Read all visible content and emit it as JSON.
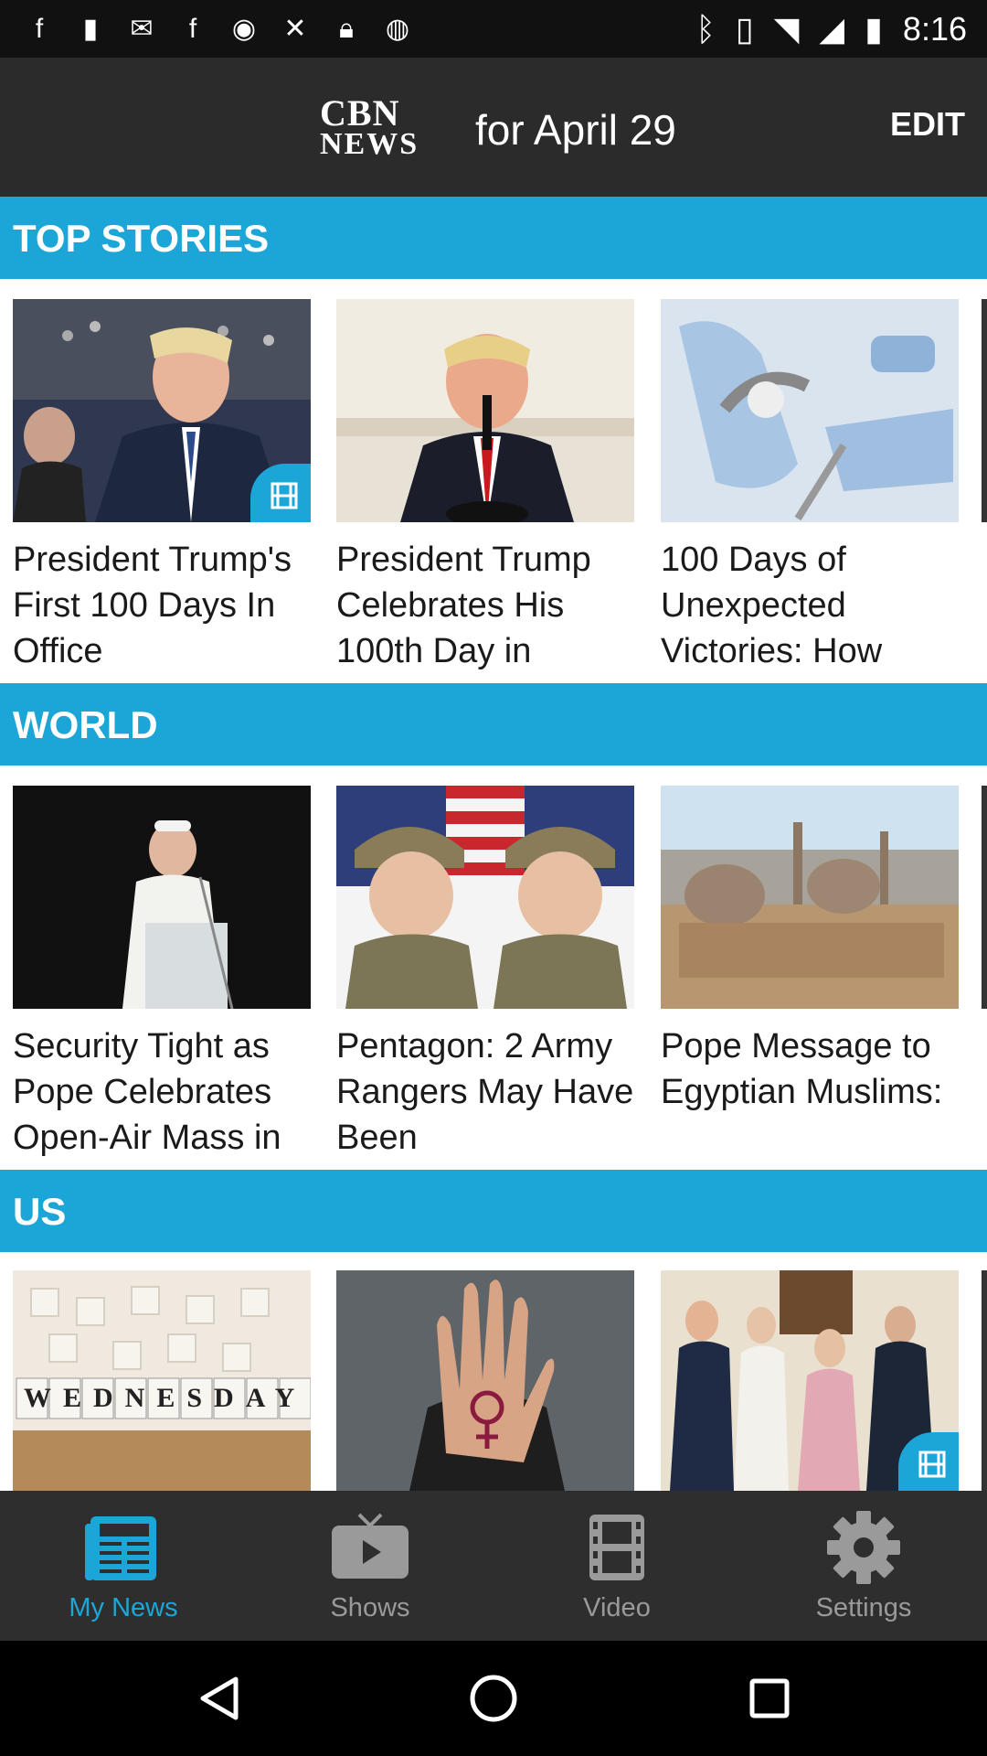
{
  "status_bar": {
    "time": "8:16",
    "left_icons": [
      "facebook-icon",
      "tip-icon",
      "gmail-icon",
      "facebook-icon",
      "circle-icon",
      "satellite-icon",
      "lock-icon",
      "app-icon"
    ],
    "right_icons": [
      "bluetooth-icon",
      "vibrate-icon",
      "wifi-icon",
      "signal-icon",
      "battery-icon"
    ]
  },
  "header": {
    "logo_line1": "CBN",
    "logo_line2": "NEWS",
    "title": "for April 29",
    "edit_label": "EDIT"
  },
  "sections": [
    {
      "label": "TOP STORIES",
      "cards": [
        {
          "caption": "President Trump's First 100 Days In Office",
          "has_video": true
        },
        {
          "caption": "President Trump Celebrates His 100th Day in",
          "has_video": false
        },
        {
          "caption": "100 Days of Unexpected Victories: How",
          "has_video": false
        }
      ]
    },
    {
      "label": "WORLD",
      "cards": [
        {
          "caption": "Security Tight as Pope Celebrates Open-Air Mass in",
          "has_video": false
        },
        {
          "caption": "Pentagon: 2 Army Rangers May Have Been",
          "has_video": false
        },
        {
          "caption": "Pope Message to Egyptian Muslims:",
          "has_video": false
        }
      ]
    },
    {
      "label": "US",
      "cards": [
        {
          "caption": "",
          "has_video": false,
          "thumb_text": "WEDNESDAY"
        },
        {
          "caption": "",
          "has_video": false
        },
        {
          "caption": "",
          "has_video": true
        }
      ]
    }
  ],
  "bottom_nav": {
    "items": [
      {
        "label": "My News",
        "icon": "newspaper-icon",
        "active": true
      },
      {
        "label": "Shows",
        "icon": "tv-play-icon",
        "active": false
      },
      {
        "label": "Video",
        "icon": "film-icon",
        "active": false
      },
      {
        "label": "Settings",
        "icon": "gear-icon",
        "active": false
      }
    ]
  },
  "colors": {
    "accent": "#1ca6d8",
    "header_bg": "#2b2b2b",
    "nav_bg": "#2e2e2e",
    "inactive": "#9a9a9a"
  }
}
